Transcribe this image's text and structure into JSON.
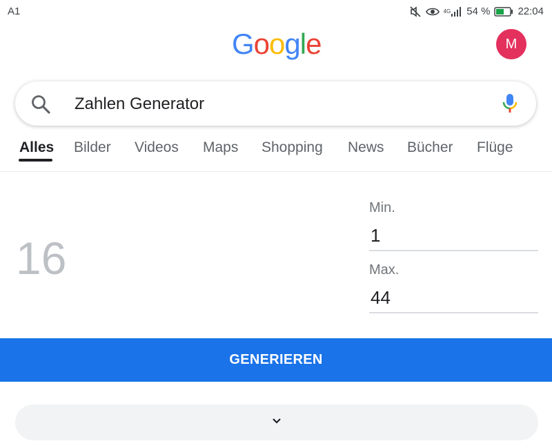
{
  "status_bar": {
    "carrier": "A1",
    "network": "4G",
    "battery": "54 %",
    "time": "22:04"
  },
  "header": {
    "logo": [
      "G",
      "o",
      "o",
      "g",
      "l",
      "e"
    ],
    "logo_colors": [
      "#4285F4",
      "#EA4335",
      "#FBBC05",
      "#4285F4",
      "#34A853",
      "#EA4335"
    ],
    "avatar_letter": "M",
    "avatar_color": "#e4305d"
  },
  "search": {
    "query": "Zahlen Generator"
  },
  "tabs": [
    {
      "label": "Alles",
      "active": true
    },
    {
      "label": "Bilder",
      "active": false
    },
    {
      "label": "Videos",
      "active": false
    },
    {
      "label": "Maps",
      "active": false
    },
    {
      "label": "Shopping",
      "active": false
    },
    {
      "label": "News",
      "active": false
    },
    {
      "label": "Bücher",
      "active": false
    },
    {
      "label": "Flüge",
      "active": false
    }
  ],
  "generator": {
    "result": "16",
    "min_label": "Min.",
    "min_value": "1",
    "max_label": "Max.",
    "max_value": "44",
    "button_label": "GENERIEREN",
    "button_color": "#1a73e8"
  },
  "icons": {
    "search": "search-icon",
    "mic": "microphone-icon",
    "expand": "chevron-down-icon",
    "mute": "mute-icon",
    "eye": "eye-icon",
    "signal": "signal-icon",
    "battery": "battery-icon"
  }
}
